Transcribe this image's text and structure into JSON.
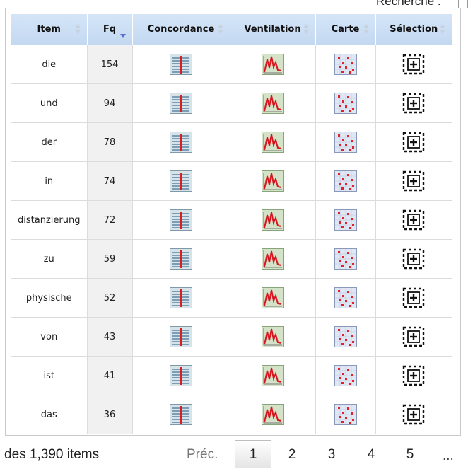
{
  "search": {
    "label": "Recherche :"
  },
  "table": {
    "headers": [
      {
        "label": "Item"
      },
      {
        "label": "Fq"
      },
      {
        "label": "Concordance"
      },
      {
        "label": "Ventilation"
      },
      {
        "label": "Carte"
      },
      {
        "label": "Sélection"
      }
    ],
    "rows": [
      {
        "item": "die",
        "fq": "154"
      },
      {
        "item": "und",
        "fq": "94"
      },
      {
        "item": "der",
        "fq": "78"
      },
      {
        "item": "in",
        "fq": "74"
      },
      {
        "item": "distanzierung",
        "fq": "72"
      },
      {
        "item": "zu",
        "fq": "59"
      },
      {
        "item": "physische",
        "fq": "52"
      },
      {
        "item": "von",
        "fq": "43"
      },
      {
        "item": "ist",
        "fq": "41"
      },
      {
        "item": "das",
        "fq": "36"
      }
    ],
    "row_icons": [
      "concordance-icon",
      "ventilation-chart-icon",
      "map-icon",
      "selection-add-icon"
    ],
    "sorted_column": "Fq",
    "sort_direction": "descending"
  },
  "pager": {
    "info": "des 1,390 items",
    "prev": "Préc.",
    "pages": [
      "1",
      "2",
      "3",
      "4",
      "5"
    ],
    "current": "1",
    "ellipsis": "..."
  },
  "colors": {
    "header_bg": "#c8dbf2",
    "fq_column_bg": "#f1f1f1",
    "chart_red": "#d8151f",
    "sort_active": "#5b6fd1"
  }
}
